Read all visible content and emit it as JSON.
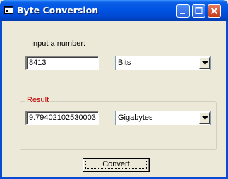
{
  "window": {
    "title": "Byte Conversion"
  },
  "input": {
    "label": "Input a number:",
    "value": "8413",
    "unit": "Bits"
  },
  "result": {
    "group_label": "Result",
    "value": "9.79402102530003",
    "unit": "Gigabytes"
  },
  "actions": {
    "convert_label": "Convert"
  }
}
